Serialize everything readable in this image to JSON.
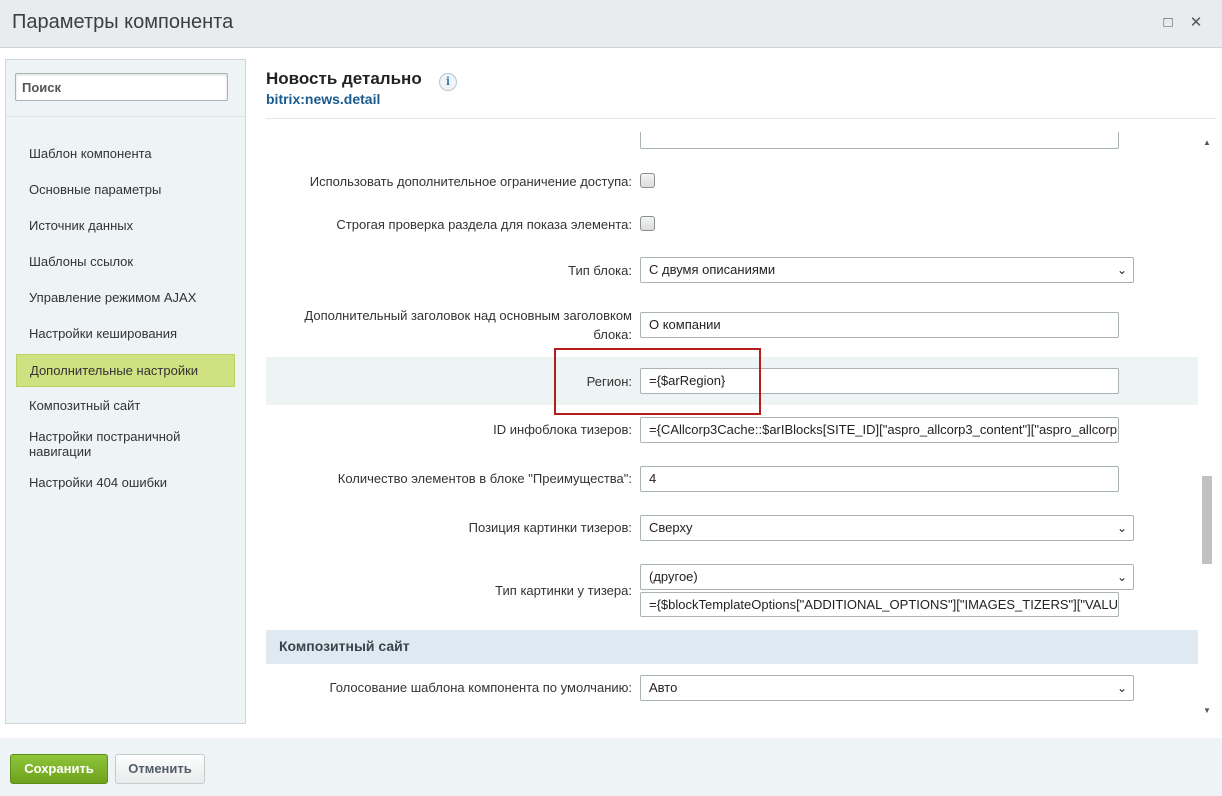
{
  "window": {
    "title": "Параметры компонента",
    "maximize_glyph": "□",
    "close_glyph": "✕"
  },
  "sidebar": {
    "search_placeholder": "Поиск",
    "items": [
      {
        "label": "Шаблон компонента"
      },
      {
        "label": "Основные параметры"
      },
      {
        "label": "Источник данных"
      },
      {
        "label": "Шаблоны ссылок"
      },
      {
        "label": "Управление режимом AJAX"
      },
      {
        "label": "Настройки кеширования"
      },
      {
        "label": "Дополнительные настройки",
        "active": true
      },
      {
        "label": "Композитный сайт"
      },
      {
        "label": "Настройки постраничной навигации"
      },
      {
        "label": "Настройки 404 ошибки"
      }
    ]
  },
  "header": {
    "title": "Новость детально",
    "info_glyph": "i",
    "component_code": "bitrix:news.detail"
  },
  "params": {
    "access_limit": {
      "label": "Использовать дополнительное ограничение доступа:",
      "checked": false
    },
    "strict_check": {
      "label": "Строгая проверка раздела для показа элемента:",
      "checked": false
    },
    "block_type": {
      "label": "Тип блока:",
      "value": "С двумя описаниями"
    },
    "extra_heading": {
      "label": "Дополнительный заголовок над основным заголовком блока:",
      "value": "О компании"
    },
    "region": {
      "label": "Регион:",
      "value": "={$arRegion}"
    },
    "tizers_iblock": {
      "label": "ID инфоблока тизеров:",
      "value": "={CAllcorp3Cache::$arIBlocks[SITE_ID][\"aspro_allcorp3_content\"][\"aspro_allcorp"
    },
    "adv_count": {
      "label": "Количество элементов в блоке \"Преимущества\":",
      "value": "4"
    },
    "tizers_pic_position": {
      "label": "Позиция картинки тизеров:",
      "value": "Сверху"
    },
    "tizer_pic_type": {
      "label": "Тип картинки у тизера:",
      "value": "(другое)",
      "custom_value": "={$blockTemplateOptions[\"ADDITIONAL_OPTIONS\"][\"IMAGES_TIZERS\"][\"VALU"
    }
  },
  "composite_section": {
    "title": "Композитный сайт",
    "voting": {
      "label": "Голосование шаблона компонента по умолчанию:",
      "value": "Авто"
    }
  },
  "footer": {
    "save_label": "Сохранить",
    "cancel_label": "Отменить"
  },
  "colors": {
    "active_item": "#cfe181",
    "section_header": "#dfe9f1",
    "save_button": "#7db52b",
    "highlight_box": "#b71c1c",
    "component_code": "#1a5b8f"
  }
}
